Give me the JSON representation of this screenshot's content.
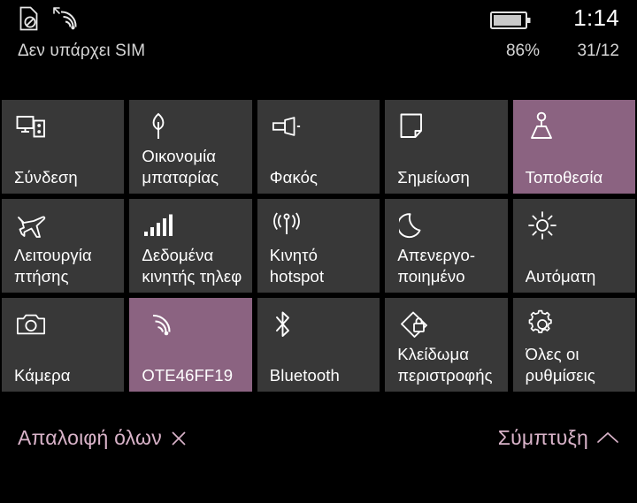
{
  "status": {
    "sim_text": "Δεν υπάρχει SIM",
    "sim_icon": "no-sim-icon",
    "wifi_icon": "wifi-signal-icon",
    "battery_icon": "battery-icon",
    "time": "1:14",
    "battery_percent": "86%",
    "date": "31/12"
  },
  "colors": {
    "accent": "#8b6381",
    "tile_background": "#383838",
    "page_background": "#000000",
    "action_link": "#d9b3c9"
  },
  "tiles": [
    {
      "label": "Σύνδεση",
      "icon": "connect-icon",
      "active": false
    },
    {
      "label": "Οικονομία\nμπαταρίας",
      "icon": "leaf-icon",
      "active": false
    },
    {
      "label": "Φακός",
      "icon": "flashlight-icon",
      "active": false
    },
    {
      "label": "Σημείωση",
      "icon": "note-icon",
      "active": false
    },
    {
      "label": "Τοποθεσία",
      "icon": "location-icon",
      "active": true
    },
    {
      "label": "Λειτουργία\nπτήσης",
      "icon": "airplane-icon",
      "active": false
    },
    {
      "label": "Δεδομένα\nκινητής τηλεφ",
      "icon": "signal-bars-icon",
      "active": false
    },
    {
      "label": "Κινητό\nhotspot",
      "icon": "hotspot-icon",
      "active": false
    },
    {
      "label": "Απενεργο-\nποιημένο",
      "icon": "moon-icon",
      "active": false
    },
    {
      "label": "Αυτόματη",
      "icon": "brightness-sun-icon",
      "active": false
    },
    {
      "label": "Κάμερα",
      "icon": "camera-icon",
      "active": false
    },
    {
      "label": "OTE46FF19",
      "icon": "wifi-icon",
      "active": true
    },
    {
      "label": "Bluetooth",
      "icon": "bluetooth-icon",
      "active": false
    },
    {
      "label": "Κλείδωμα\nπεριστροφής",
      "icon": "rotation-lock-icon",
      "active": false
    },
    {
      "label": "Όλες οι\nρυθμίσεις",
      "icon": "gear-icon",
      "active": false
    }
  ],
  "action_bar": {
    "clear_all_label": "Απαλοιφή όλων",
    "clear_all_icon": "close-x-icon",
    "collapse_label": "Σύμπτυξη",
    "collapse_icon": "chevron-up-icon"
  }
}
